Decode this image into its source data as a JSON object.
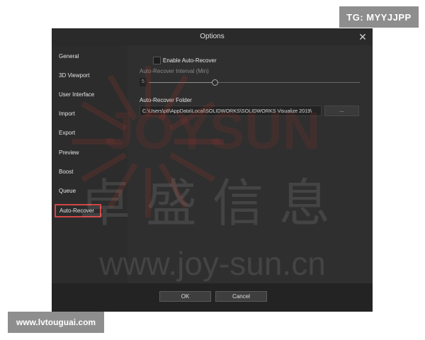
{
  "overlays": {
    "top_tag": "TG: MYYJJPP",
    "bottom_tag": "www.lvtouguai.com"
  },
  "dialog": {
    "title": "Options",
    "close_icon": "close-icon"
  },
  "sidebar": {
    "items": [
      {
        "label": "General"
      },
      {
        "label": "3D Viewport"
      },
      {
        "label": "User Interface"
      },
      {
        "label": "Import"
      },
      {
        "label": "Export"
      },
      {
        "label": "Preview"
      },
      {
        "label": "Boost"
      },
      {
        "label": "Queue"
      },
      {
        "label": "Auto-Recover",
        "active": true
      }
    ]
  },
  "content": {
    "enable_label": "Enable Auto-Recover",
    "enable_checked": false,
    "interval_label": "Auto-Recover Interval (Min)",
    "interval_value": "5",
    "folder_label": "Auto-Recover Folder",
    "folder_value": "C:\\Users\\p8\\AppData\\Local\\SOLIDWORKS\\SOLIDWORKS Visualize 2019\\",
    "browse_label": "..."
  },
  "footer": {
    "ok_label": "OK",
    "cancel_label": "Cancel"
  },
  "watermark": {
    "text_en": "www.joy-sun.cn",
    "text_cn": "卓盛信息",
    "logo_text": "JOYSUN",
    "color": "#c0392b"
  },
  "colors": {
    "dialog_bg": "#2b2b2b",
    "active_border": "#d24545"
  }
}
